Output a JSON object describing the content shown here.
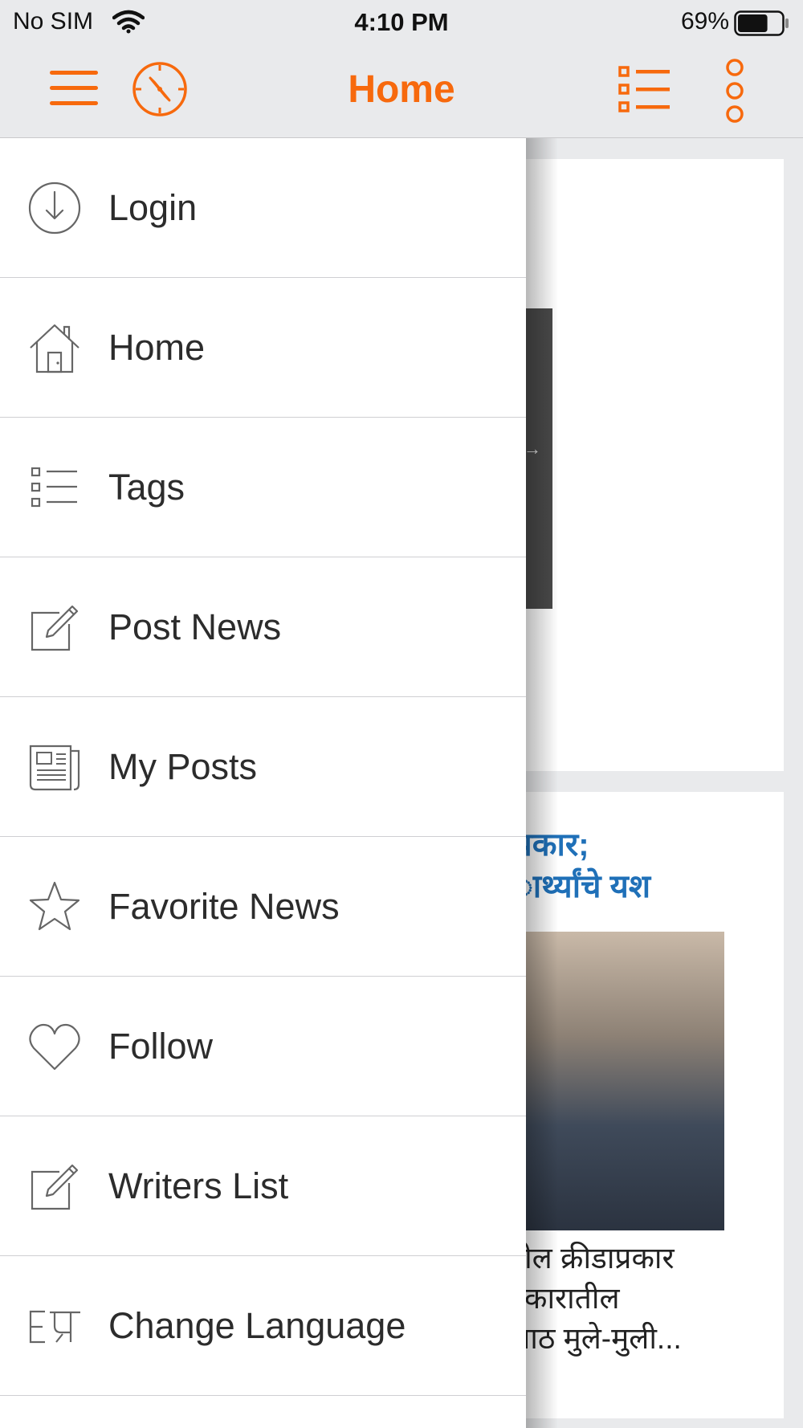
{
  "status_bar": {
    "carrier": "No SIM",
    "time": "4:10 PM",
    "battery_percent": "69%",
    "battery_level": 0.69
  },
  "nav": {
    "title": "Home",
    "accent_color": "#f7690d"
  },
  "drawer": {
    "items": [
      {
        "label": "Login",
        "icon": "login-icon"
      },
      {
        "label": "Home",
        "icon": "home-icon"
      },
      {
        "label": "Tags",
        "icon": "tags-icon"
      },
      {
        "label": "Post News",
        "icon": "edit-icon"
      },
      {
        "label": "My Posts",
        "icon": "newspaper-icon"
      },
      {
        "label": "Favorite News",
        "icon": "star-icon"
      },
      {
        "label": "Follow",
        "icon": "heart-icon"
      },
      {
        "label": "Writers List",
        "icon": "edit-icon"
      },
      {
        "label": "Change Language",
        "icon": "language-icon"
      }
    ]
  },
  "background_feed": {
    "headline": "प्रकार;\nार्थ्यांचे यश",
    "headline_color": "#1f70b8",
    "summary": "तील क्रीडाप्रकार\nप्रकारातील\nआठ मुले-मुली..."
  }
}
